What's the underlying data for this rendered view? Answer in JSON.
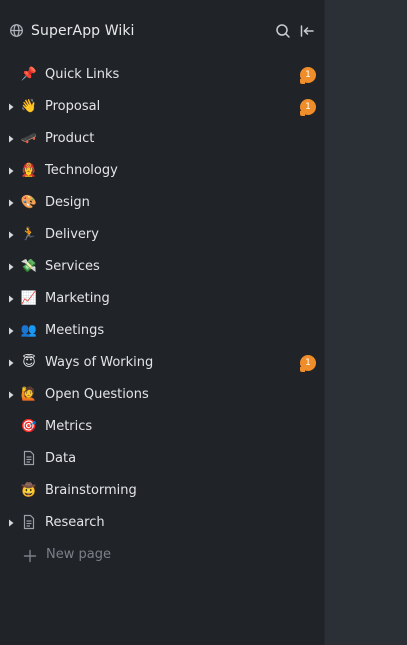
{
  "workspace": {
    "title": "SuperApp Wiki",
    "icon": "globe-icon"
  },
  "header_actions": [
    {
      "name": "search-icon"
    },
    {
      "name": "collapse-sidebar-icon"
    }
  ],
  "colors": {
    "sidebar_bg": "#202328",
    "main_bg": "#2b2f36",
    "badge": "#ee8d2a",
    "muted": "#7b8089"
  },
  "tree": [
    {
      "label": "Quick Links",
      "emoji": "📌",
      "has_children": false,
      "badge": "1"
    },
    {
      "label": "Proposal",
      "emoji": "👋",
      "has_children": true,
      "badge": "1"
    },
    {
      "label": "Product",
      "emoji": "🛹",
      "has_children": true,
      "badge": null
    },
    {
      "label": "Technology",
      "emoji": "👩‍🚒",
      "has_children": true,
      "badge": null
    },
    {
      "label": "Design",
      "emoji": "🎨",
      "has_children": true,
      "badge": null
    },
    {
      "label": "Delivery",
      "emoji": "🏃",
      "has_children": true,
      "badge": null
    },
    {
      "label": "Services",
      "emoji": "💸",
      "has_children": true,
      "badge": null
    },
    {
      "label": "Marketing",
      "emoji": "📈",
      "has_children": true,
      "badge": null
    },
    {
      "label": "Meetings",
      "emoji": "👥",
      "has_children": true,
      "badge": null
    },
    {
      "label": "Ways of Working",
      "emoji": "😇",
      "has_children": true,
      "badge": "1"
    },
    {
      "label": "Open Questions",
      "emoji": "🙋",
      "has_children": true,
      "badge": null
    },
    {
      "label": "Metrics",
      "emoji": "🎯",
      "has_children": false,
      "badge": null
    },
    {
      "label": "Data",
      "emoji": "",
      "icon": "document-icon",
      "has_children": false,
      "badge": null
    },
    {
      "label": "Brainstorming",
      "emoji": "🤠",
      "has_children": false,
      "badge": null
    },
    {
      "label": "Research",
      "emoji": "",
      "icon": "document-icon",
      "has_children": true,
      "badge": null
    }
  ],
  "new_page": {
    "label": "New page"
  }
}
